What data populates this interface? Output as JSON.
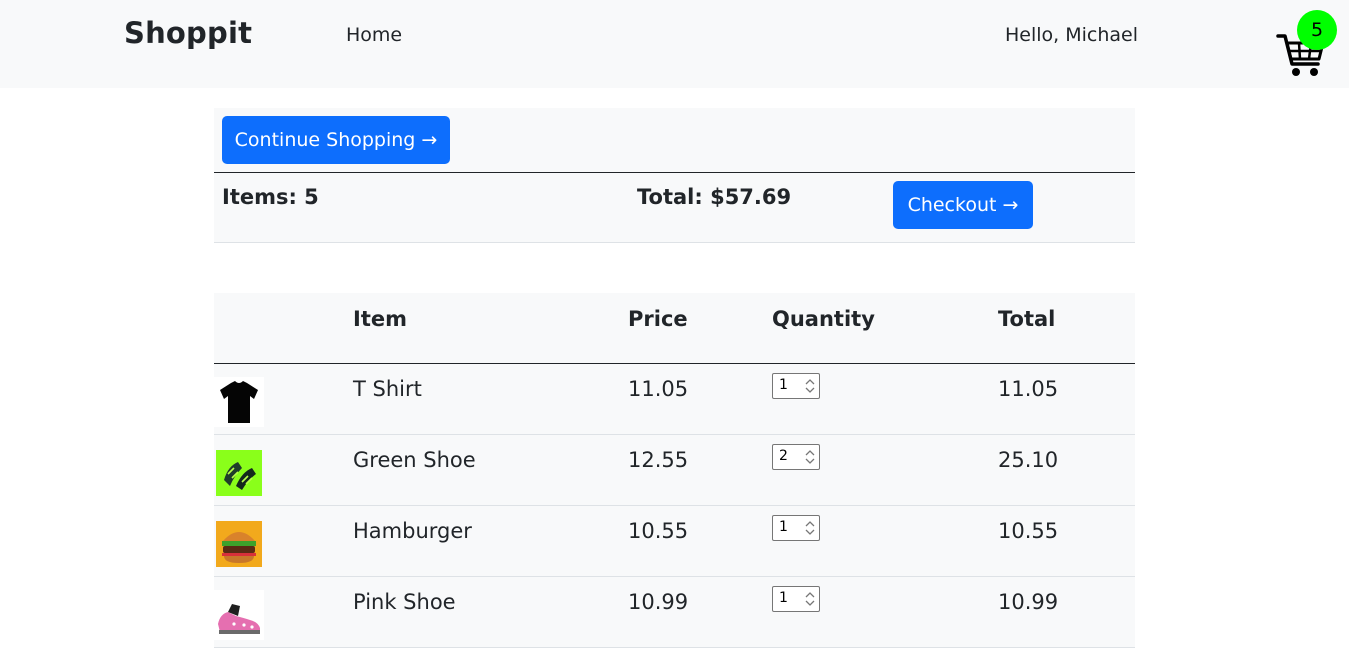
{
  "navbar": {
    "brand": "Shoppit",
    "home_label": "Home",
    "greeting": "Hello, Michael",
    "cart_icon": "shopping-cart-icon",
    "cart_count": "5",
    "badge_color": "#00ff00"
  },
  "summary": {
    "continue_label": "Continue Shopping →",
    "items_label": "Items: 5",
    "total_label": "Total: $57.69",
    "checkout_label": "Checkout →",
    "accent_color": "#0d6efd"
  },
  "table": {
    "headers": [
      "",
      "Item",
      "Price",
      "Quantity",
      "Total"
    ],
    "rows": [
      {
        "image": "t-shirt-image",
        "name": "T Shirt",
        "price": "11.05",
        "quantity": "1",
        "total": "11.05"
      },
      {
        "image": "green-shoe-image",
        "name": "Green Shoe",
        "price": "12.55",
        "quantity": "2",
        "total": "25.10"
      },
      {
        "image": "hamburger-image",
        "name": "Hamburger",
        "price": "10.55",
        "quantity": "1",
        "total": "10.55"
      },
      {
        "image": "pink-shoe-image",
        "name": "Pink Shoe",
        "price": "10.99",
        "quantity": "1",
        "total": "10.99"
      }
    ]
  }
}
